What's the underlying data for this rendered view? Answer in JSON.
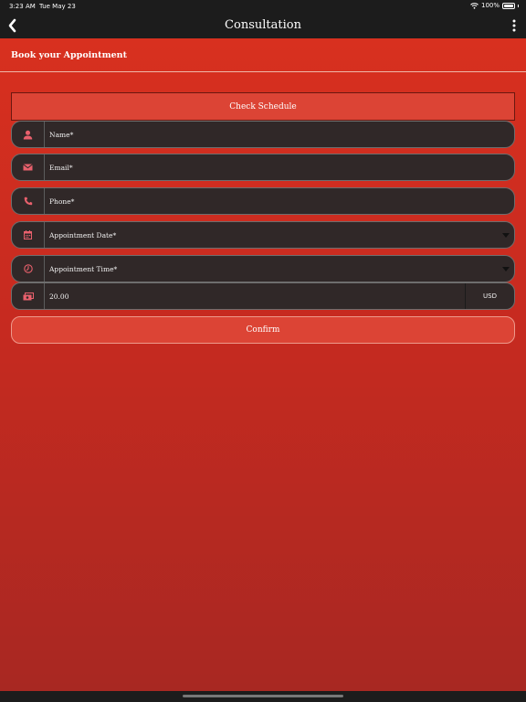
{
  "status_bar": {
    "time": "3:23 AM",
    "date": "Tue May 23",
    "battery": "100%"
  },
  "nav": {
    "title": "Consultation"
  },
  "section": {
    "title": "Book your Appointment"
  },
  "buttons": {
    "check_schedule": "Check Schedule",
    "confirm": "Confirm"
  },
  "fields": {
    "name": {
      "label": "Name*",
      "icon": "person-icon"
    },
    "email": {
      "label": "Email*",
      "icon": "envelope-icon"
    },
    "phone": {
      "label": "Phone*",
      "icon": "phone-icon"
    },
    "date": {
      "label": "Appointment Date*",
      "icon": "calendar-icon"
    },
    "time": {
      "label": "Appointment Time*",
      "icon": "clock-icon"
    },
    "amount": {
      "value": "20.00",
      "currency": "USD",
      "icon": "money-icon"
    }
  },
  "colors": {
    "accent": "#d8301f",
    "field_bg": "#302828",
    "icon": "#e8606c"
  }
}
